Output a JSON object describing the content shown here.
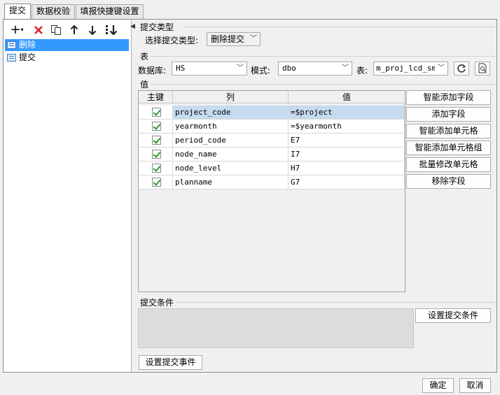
{
  "tabs": [
    {
      "label": "提交",
      "active": true
    },
    {
      "label": "数据校验",
      "active": false
    },
    {
      "label": "填报快捷键设置",
      "active": false
    }
  ],
  "tree": {
    "items": [
      {
        "label": "删除",
        "selected": true
      },
      {
        "label": "提交",
        "selected": false
      }
    ]
  },
  "submit_type": {
    "section": "提交类型",
    "label": "选择提交类型:",
    "value": "删除提交"
  },
  "table": {
    "section": "表",
    "db_label": "数据库:",
    "db_value": "HS",
    "schema_label": "模式:",
    "schema_value": "dbo",
    "table_label": "表:",
    "table_value": "m_proj_lcd_sm"
  },
  "values": {
    "section": "值",
    "headers": [
      "主键",
      "列",
      "值"
    ],
    "rows": [
      {
        "key": true,
        "column": "project_code",
        "value": "=$project"
      },
      {
        "key": true,
        "column": "yearmonth",
        "value": "=$yearmonth"
      },
      {
        "key": true,
        "column": "period_code",
        "value": "E7"
      },
      {
        "key": true,
        "column": "node_name",
        "value": "I7"
      },
      {
        "key": true,
        "column": "node_level",
        "value": "H7"
      },
      {
        "key": true,
        "column": "planname",
        "value": "G7"
      }
    ],
    "buttons": [
      "智能添加字段",
      "添加字段",
      "智能添加单元格",
      "智能添加单元格组",
      "批量修改单元格",
      "移除字段"
    ]
  },
  "condition": {
    "section": "提交条件",
    "button": "设置提交条件"
  },
  "event_button": "设置提交事件",
  "footer": {
    "ok": "确定",
    "cancel": "取消"
  },
  "colors": {
    "selection": "#3399ff",
    "row_selected": "#c6daf0",
    "delete_red": "#e02020",
    "check_green": "#2a9a2a"
  }
}
